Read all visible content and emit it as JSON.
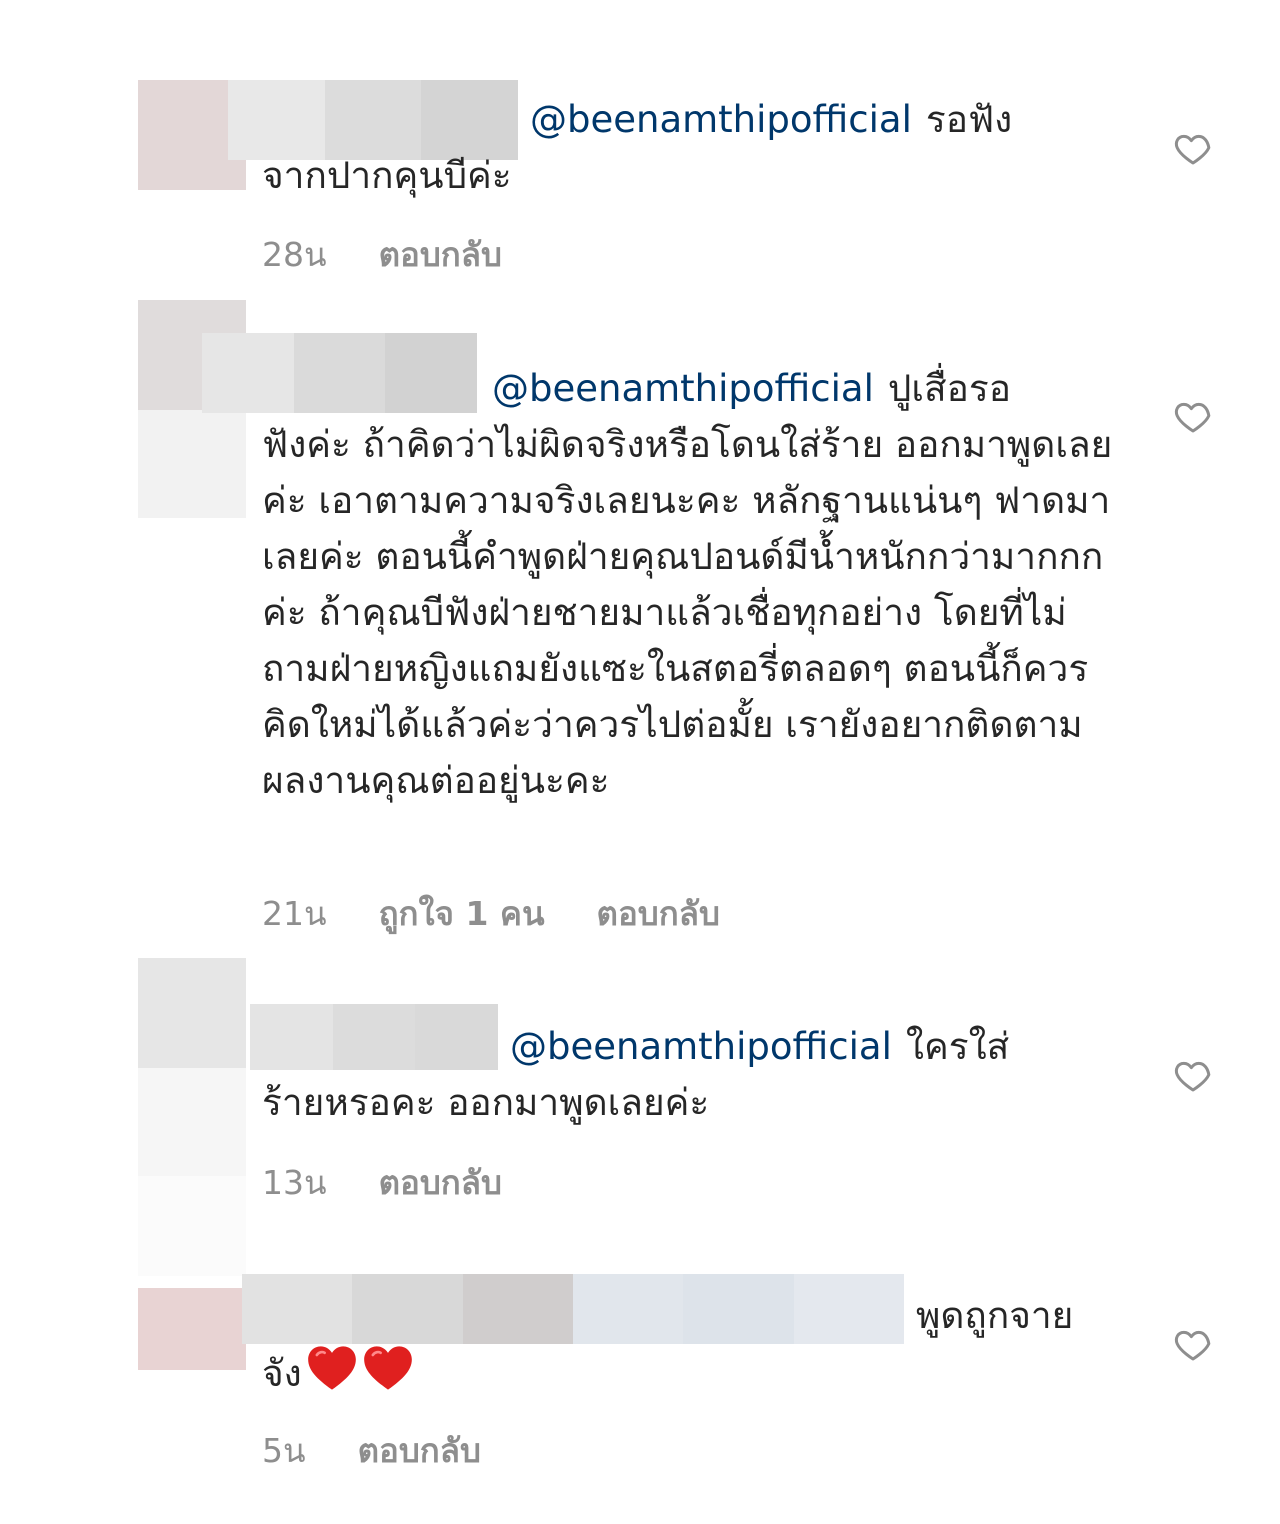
{
  "comments": [
    {
      "mention": "@beenamthipofficial",
      "line1": "รอฟัง",
      "rest": "จากปากคุนบีค่ะ",
      "time": "28น",
      "likes": "",
      "reply": "ตอบกลับ",
      "avatar_colors": [
        "#e3d7d7",
        "#ffffff"
      ],
      "blur_colors": [
        "#e8e8e8",
        "#dcdcdc",
        "#d4d4d4"
      ]
    },
    {
      "mention": "@beenamthipofficial",
      "line1": "ปูเสื่อรอ",
      "rest": "ฟังค่ะ ถ้าคิดว่าไม่ผิดจริงหรือโดนใส่ร้าย ออกมาพูดเลยค่ะ เอาตามความจริงเลยนะคะ  หลักฐานแน่นๆ ฟาดมาเลยค่ะ ตอนนี้คำพูดฝ่ายคุณปอนด์มีน้ำหนักกว่ามากกกค่ะ ถ้าคุณบีฟังฝ่ายชายมาแล้วเชื่อทุกอย่าง โดยที่ไม่ถามฝ่ายหญิงแถมยังแซะในสตอรี่ตลอดๆ ตอนนี้ก็ควรคิดใหม่ได้แล้วค่ะว่าควรไปต่อมั้ย เรายังอยากติดตามผลงานคุณต่ออยู่นะคะ",
      "time": "21น",
      "likes": "ถูกใจ 1 คน",
      "reply": "ตอบกลับ",
      "avatar_colors": [
        "#e0dcdc",
        "#f2f2f2"
      ],
      "blur_colors": [
        "#e6e6e6",
        "#dadada",
        "#d2d2d2"
      ]
    },
    {
      "mention": "@beenamthipofficial",
      "line1": "ใครใส่",
      "rest": "ร้ายหรอคะ ออกมาพูดเลยค่ะ",
      "time": "13น",
      "likes": "",
      "reply": "ตอบกลับ",
      "avatar_colors": [
        "#e6e6e6",
        "#f6f6f6"
      ],
      "blur_colors": [
        "#e4e4e4",
        "#dcdcdc",
        "#d9d9d9"
      ]
    },
    {
      "mention": "",
      "line1": "พูดถูกจาย",
      "rest": "จัง",
      "emoji": [
        "red-heart",
        "red-heart"
      ],
      "time": "5น",
      "likes": "",
      "reply": "ตอบกลับ",
      "avatar_colors": [
        "#e8d3d3",
        "#ffffff"
      ],
      "blur_colors": [
        "#e2e2e2",
        "#d8d8d8",
        "#d0cdcd",
        "#e1e6ec",
        "#dde3ea",
        "#e4e8ee"
      ]
    }
  ],
  "colors": {
    "mention": "#00376b",
    "meta": "#8e8e8e",
    "heart_outline": "#8e8e8e",
    "emoji_heart": "#e0201f"
  }
}
